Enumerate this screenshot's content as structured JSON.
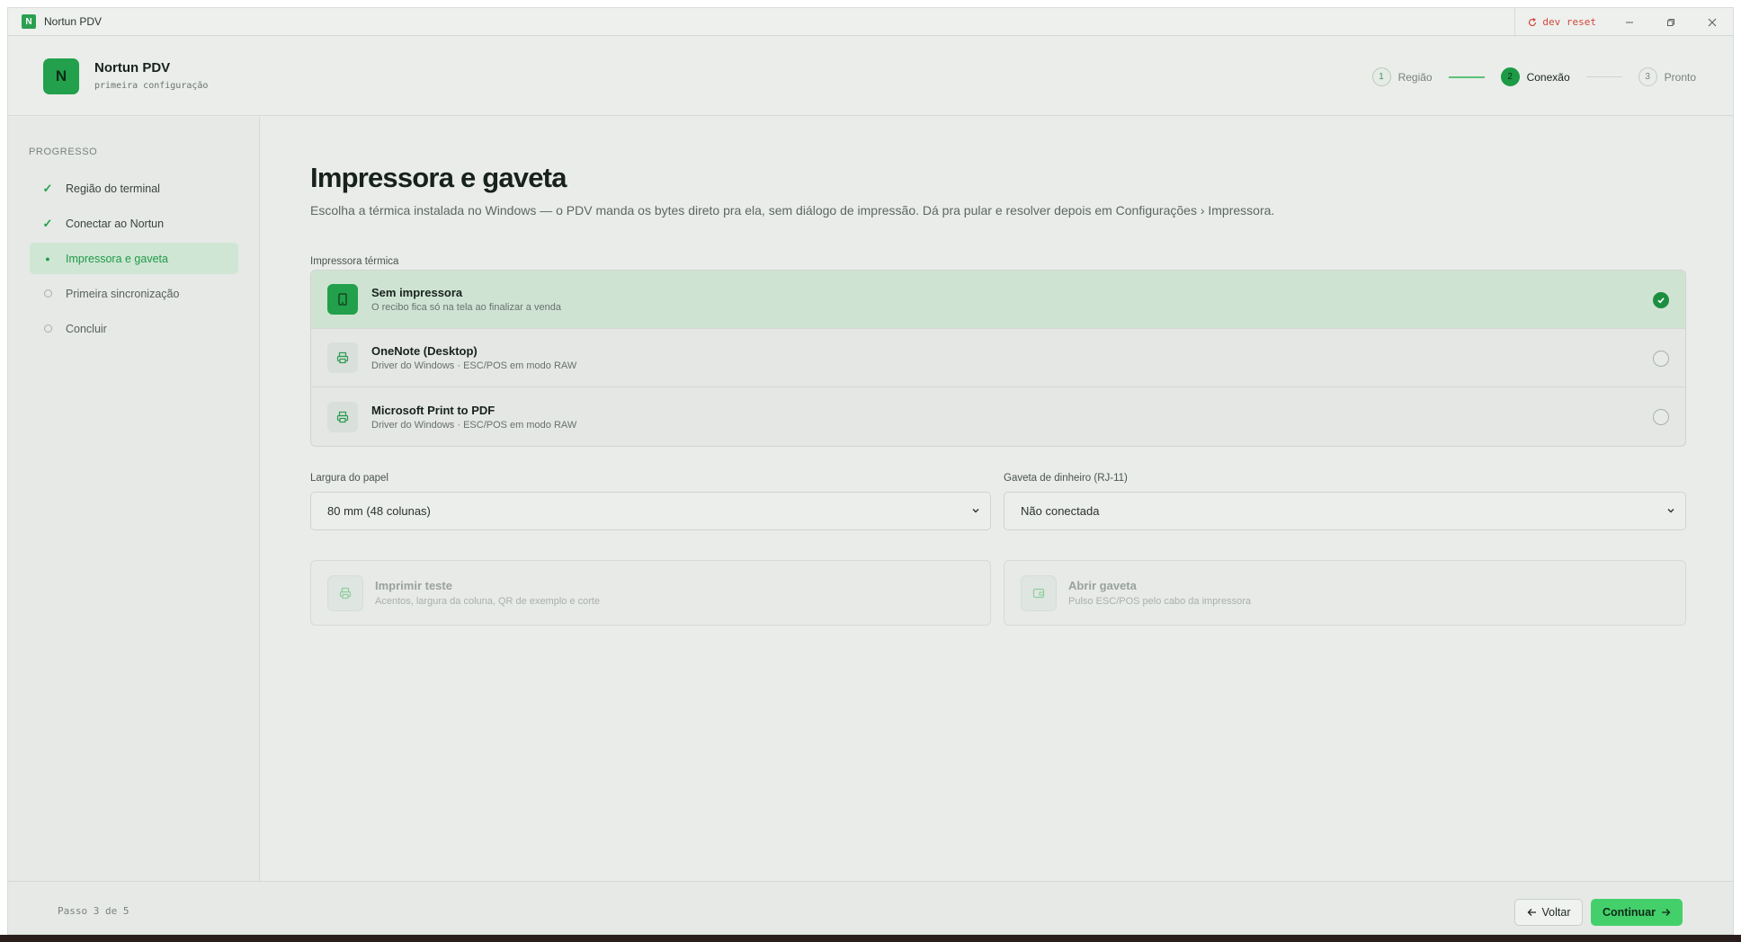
{
  "titlebar": {
    "app_title": "Nortun PDV",
    "logo_letter": "N",
    "dev_reset_label": "dev reset",
    "minimize_icon": "minimize-icon",
    "restore_icon": "restore-icon",
    "close_icon": "close-icon"
  },
  "header": {
    "logo_letter": "N",
    "app_name": "Nortun PDV",
    "subtitle": "primeira configuração",
    "steps": [
      {
        "num": "1",
        "label": "Região",
        "state": "done"
      },
      {
        "num": "2",
        "label": "Conexão",
        "state": "active"
      },
      {
        "num": "3",
        "label": "Pronto",
        "state": "todo"
      }
    ]
  },
  "sidebar": {
    "title": "PROGRESSO",
    "items": [
      {
        "label": "Região do terminal",
        "state": "done"
      },
      {
        "label": "Conectar ao Nortun",
        "state": "done"
      },
      {
        "label": "Impressora e gaveta",
        "state": "current"
      },
      {
        "label": "Primeira sincronização",
        "state": "pending"
      },
      {
        "label": "Concluir",
        "state": "pending"
      }
    ]
  },
  "main": {
    "title": "Impressora e gaveta",
    "lead": "Escolha a térmica instalada no Windows — o PDV manda os bytes direto pra ela, sem diálogo de impressão. Dá pra pular e resolver depois em Configurações › Impressora.",
    "printer_label": "Impressora térmica",
    "printers": [
      {
        "name": "Sem impressora",
        "sub": "O recibo fica só na tela ao finalizar a venda",
        "selected": true,
        "icon": "screen-icon"
      },
      {
        "name": "OneNote (Desktop)",
        "sub": "Driver do Windows · ESC/POS em modo RAW",
        "selected": false,
        "icon": "printer-icon"
      },
      {
        "name": "Microsoft Print to PDF",
        "sub": "Driver do Windows · ESC/POS em modo RAW",
        "selected": false,
        "icon": "printer-icon"
      }
    ],
    "paper_label": "Largura do papel",
    "paper_value": "80 mm (48 colunas)",
    "drawer_label": "Gaveta de dinheiro (RJ-11)",
    "drawer_value": "Não conectada",
    "actions": [
      {
        "name": "Imprimir teste",
        "sub": "Acentos, largura da coluna, QR de exemplo e corte",
        "icon": "printer-icon"
      },
      {
        "name": "Abrir gaveta",
        "sub": "Pulso ESC/POS pelo cabo da impressora",
        "icon": "drawer-icon"
      }
    ]
  },
  "footer": {
    "step_count": "Passo 3 de 5",
    "back_label": "Voltar",
    "next_label": "Continuar"
  },
  "colors": {
    "accent": "#22a04b",
    "accent_light": "#43d06b",
    "danger": "#d3463a"
  }
}
